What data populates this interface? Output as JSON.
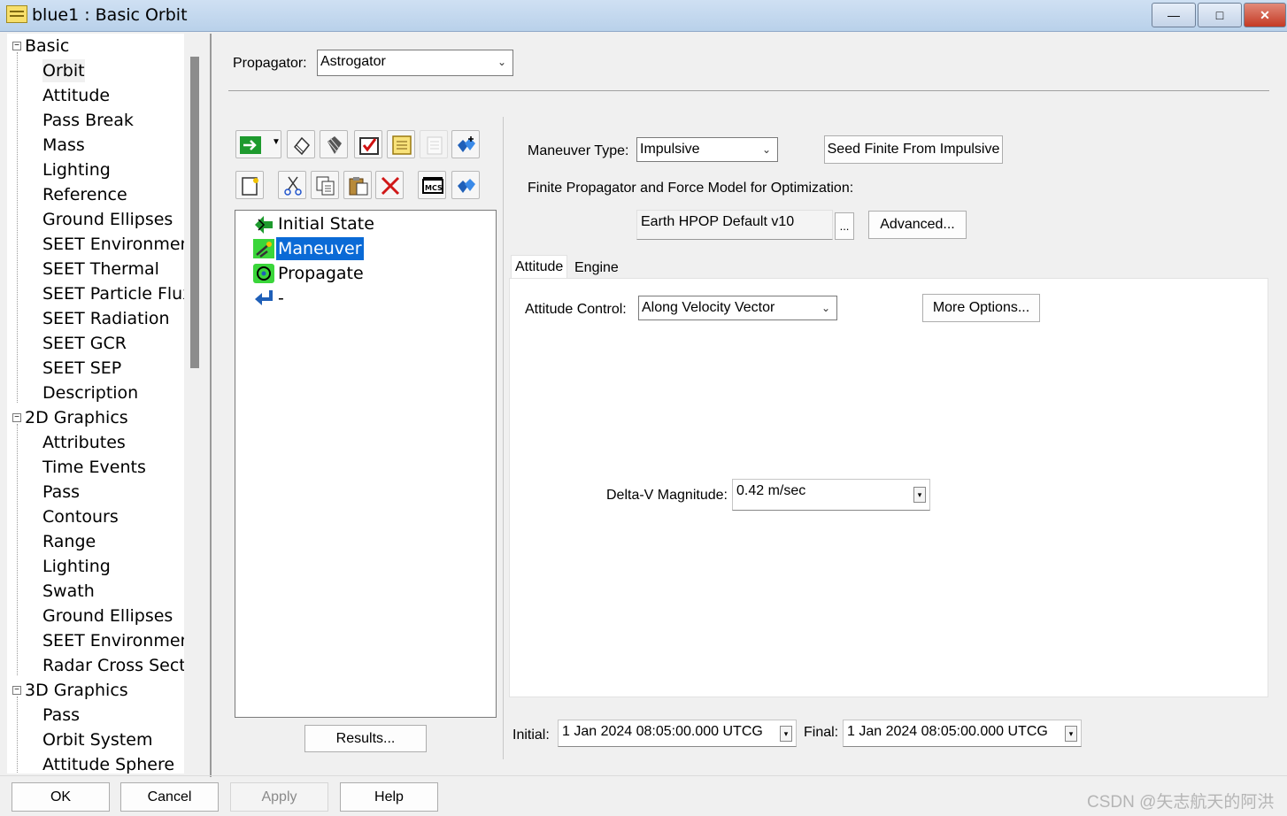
{
  "window": {
    "title": "blue1 : Basic Orbit",
    "minimize": "—",
    "maximize": "□",
    "close": "✕"
  },
  "tree": {
    "categories": [
      {
        "label": "Basic",
        "toggle": "⊟",
        "items": [
          "Orbit",
          "Attitude",
          "Pass Break",
          "Mass",
          "Lighting",
          "Reference",
          "Ground Ellipses",
          "SEET Environment",
          "SEET Thermal",
          "SEET Particle Flux",
          "SEET Radiation",
          "SEET GCR",
          "SEET SEP",
          "Description"
        ]
      },
      {
        "label": "2D Graphics",
        "toggle": "⊟",
        "items": [
          "Attributes",
          "Time Events",
          "Pass",
          "Contours",
          "Range",
          "Lighting",
          "Swath",
          "Ground Ellipses",
          "SEET Environment",
          "Radar Cross Sect..."
        ]
      },
      {
        "label": "3D Graphics",
        "toggle": "⊟",
        "items": [
          "Pass",
          "Orbit System",
          "Attitude Sphere"
        ]
      }
    ],
    "selected": "Orbit"
  },
  "propagator": {
    "label": "Propagator:",
    "value": "Astrogator"
  },
  "toolbar": {
    "row1": [
      "run-arrow-icon",
      "dropdown-arrow-icon",
      "eraser-icon",
      "clear-all-icon",
      "checklist-icon",
      "notes-icon",
      "disabled-notes-icon",
      "cube-add-icon"
    ],
    "row2": [
      "new-page-icon",
      "cut-icon",
      "copy-icon",
      "paste-icon",
      "delete-icon",
      "mcs-icon",
      "cube-icon"
    ]
  },
  "mcs": {
    "segments": [
      {
        "label": "Initial State",
        "icon": "initial-state-icon"
      },
      {
        "label": "Maneuver",
        "icon": "maneuver-icon",
        "selected": true
      },
      {
        "label": "Propagate",
        "icon": "propagate-icon"
      },
      {
        "label": "-",
        "icon": "return-icon"
      }
    ],
    "results_button": "Results..."
  },
  "maneuver": {
    "type_label": "Maneuver Type:",
    "type_value": "Impulsive",
    "seed_button": "Seed Finite From Impulsive",
    "finite_label": "Finite Propagator and Force Model for Optimization:",
    "finite_value": "Earth HPOP Default v10",
    "ellipsis_button": "...",
    "advanced_button": "Advanced...",
    "tabs": [
      "Attitude",
      "Engine"
    ],
    "active_tab": "Attitude",
    "attitude_control_label": "Attitude Control:",
    "attitude_control_value": "Along Velocity Vector",
    "more_options_button": "More Options...",
    "delta_v_label": "Delta-V Magnitude:",
    "delta_v_value": "0.42 m/sec"
  },
  "times": {
    "initial_label": "Initial:",
    "initial_value": "1 Jan 2024 08:05:00.000 UTCG",
    "final_label": "Final:",
    "final_value": "1 Jan 2024 08:05:00.000 UTCG"
  },
  "footer": {
    "ok": "OK",
    "cancel": "Cancel",
    "apply": "Apply",
    "help": "Help"
  },
  "watermark": "CSDN @矢志航天的阿洪",
  "colors": {
    "selection": "#0a6ad6",
    "titlebar": "#b9d1ea",
    "close": "#c43a24"
  }
}
